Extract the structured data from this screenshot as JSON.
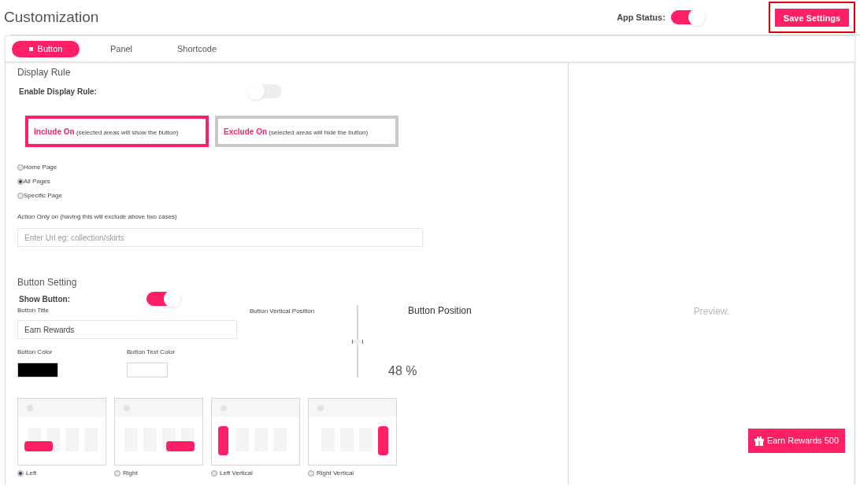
{
  "title": "Customization",
  "app_status": {
    "label": "App Status:",
    "on": true
  },
  "save_button": "Save Settings",
  "tabs": [
    {
      "label": "Button",
      "selected": true
    },
    {
      "label": "Panel",
      "selected": false
    },
    {
      "label": "Shortcode",
      "selected": false
    }
  ],
  "display_rule": {
    "heading": "Display Rule",
    "enable_label": "Enable Display Rule:",
    "enabled": false,
    "modes": [
      {
        "title": "Include On",
        "note": "(selected areas will show the button)",
        "selected": true
      },
      {
        "title": "Exclude On",
        "note": "(selected areas will hide the button)",
        "selected": false
      }
    ],
    "pages": [
      {
        "label": "Home Page",
        "selected": false
      },
      {
        "label": "All Pages",
        "selected": true
      },
      {
        "label": "Specific Page",
        "selected": false
      }
    ],
    "action_label": "Action Only on (having this will exclude above two cases)",
    "url_placeholder": "Enter Url eg: collection/skirts"
  },
  "button_setting": {
    "heading": "Button Setting",
    "show_label": "Show Button:",
    "show": true,
    "title_label": "Button Title",
    "title_value": "Earn Rewards",
    "swatches": [
      {
        "label": "Button Color",
        "color": "#000000"
      },
      {
        "label": "Button Text Color",
        "color": "#ffffff"
      }
    ],
    "vertical_label": "Button Vertical Position",
    "vertical": {
      "level": 0.48
    },
    "reading": "48 %",
    "position_heading": "Button Position",
    "positions": [
      {
        "kind": "left",
        "label": "Left",
        "selected": true
      },
      {
        "kind": "right",
        "label": "Right",
        "selected": false
      },
      {
        "kind": "left_vertical",
        "label": "Left Vertical",
        "selected": false
      },
      {
        "kind": "right_vertical",
        "label": "Right Vertical",
        "selected": false
      }
    ]
  },
  "preview": {
    "placeholder": "Preview.",
    "button": "Earn Rewards 500"
  }
}
